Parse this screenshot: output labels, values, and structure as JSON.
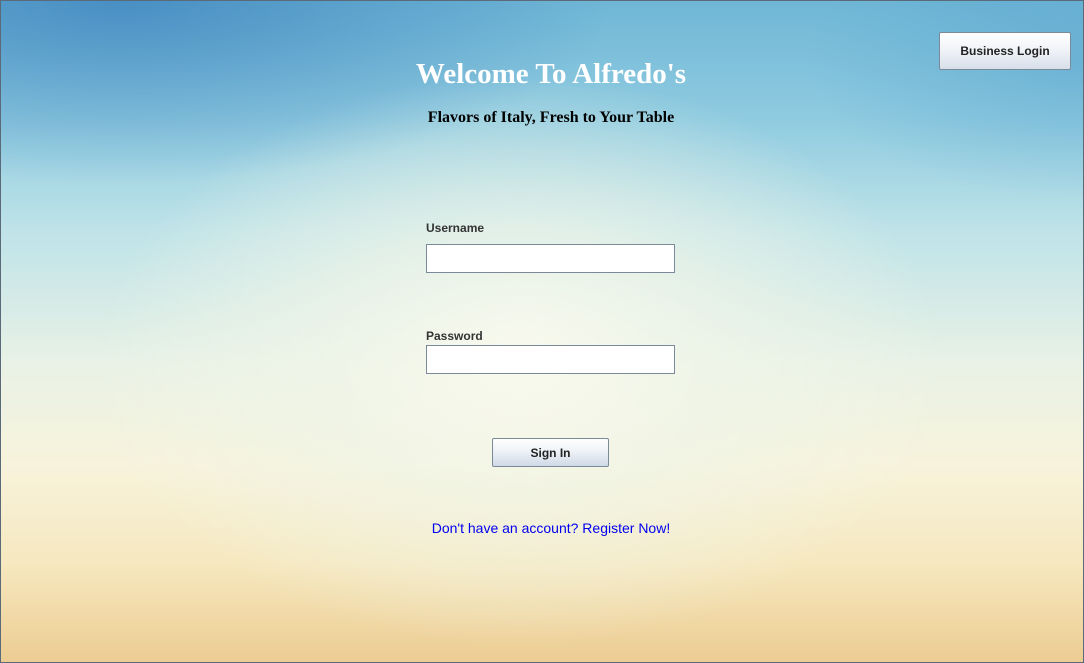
{
  "header": {
    "business_login_label": "Business Login",
    "title": "Welcome To Alfredo's",
    "subtitle": "Flavors of Italy, Fresh to Your Table"
  },
  "form": {
    "username_label": "Username",
    "username_value": "",
    "password_label": "Password",
    "password_value": "",
    "sign_in_label": "Sign In"
  },
  "footer": {
    "register_link": "Don't have an account? Register Now!"
  },
  "colors": {
    "title": "#ffffff",
    "link": "#0000ee",
    "sky_top": "#6fb6d6",
    "sunset_bottom": "#eccc92"
  }
}
